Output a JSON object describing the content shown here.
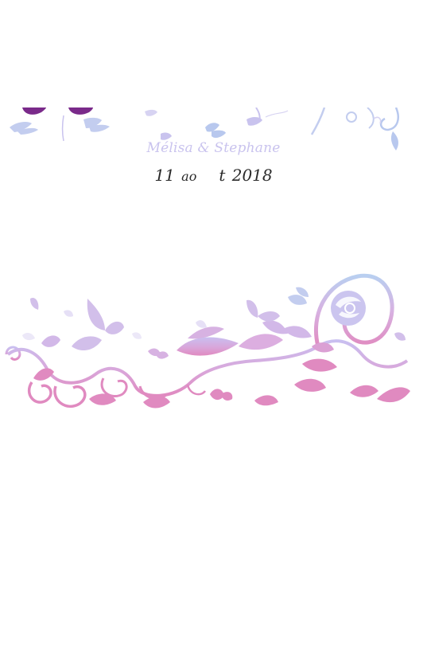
{
  "invitation": {
    "names": "Mélisa & Stephane",
    "date_day": "11",
    "date_month_part1": "ao",
    "date_month_part2": "t",
    "date_year": "2018"
  },
  "colors": {
    "names_text": "#c9c3ee",
    "date_text": "#2a2a2a",
    "lilac": "#c9bff0",
    "pink": "#e08ac0",
    "lavender": "#b9cff0",
    "deep_purple": "#7a2a8a"
  },
  "decor": {
    "top_banner": "butterfly-and-vine-banner",
    "bottom_ornament": "floral-swirl-with-butterflies"
  }
}
